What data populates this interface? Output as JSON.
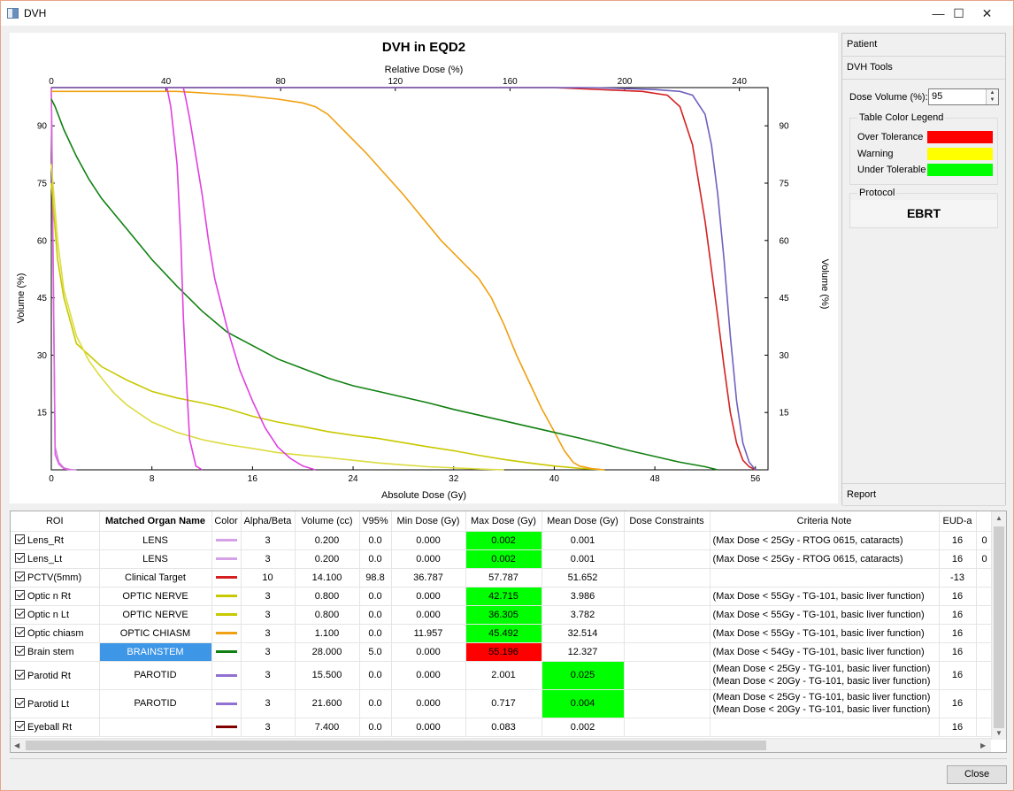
{
  "window": {
    "title": "DVH",
    "minimize": "—",
    "maximize": "☐",
    "close": "✕"
  },
  "chart": {
    "title": "DVH in EQD2",
    "top_axis_label": "Relative Dose (%)",
    "bottom_axis_label": "Absolute Dose (Gy)",
    "left_axis_label": "Volume (%)",
    "right_axis_label": "Volume (%)"
  },
  "chart_data": {
    "type": "line",
    "title": "DVH in EQD2",
    "xlabel": "Absolute Dose (Gy)",
    "x2label": "Relative Dose (%)",
    "ylabel": "Volume (%)",
    "xlim": [
      0,
      57
    ],
    "x2lim": [
      0,
      250
    ],
    "ylim": [
      0,
      100
    ],
    "x_ticks": [
      0,
      8,
      16,
      24,
      32,
      40,
      48,
      56
    ],
    "x2_ticks": [
      0,
      40,
      80,
      120,
      160,
      200,
      240
    ],
    "y_ticks": [
      15,
      30,
      45,
      60,
      75,
      90
    ],
    "series": [
      {
        "color": "#cc88dd",
        "x": [
          0,
          0.3,
          0.6,
          1,
          1.5,
          2
        ],
        "y": [
          100,
          6,
          2,
          0.5,
          0.1,
          0
        ]
      },
      {
        "color": "#e060e0",
        "x": [
          0,
          0.3,
          0.6,
          1,
          1.5
        ],
        "y": [
          100,
          4,
          1.5,
          0.3,
          0
        ]
      },
      {
        "color": "#d42020",
        "x": [
          0,
          40,
          47,
          49,
          50,
          51,
          52,
          53,
          53.5,
          54,
          54.5,
          55,
          55.5,
          56
        ],
        "y": [
          100,
          100,
          99,
          98,
          95,
          85,
          65,
          40,
          27,
          15,
          7,
          2.5,
          0.8,
          0
        ]
      },
      {
        "color": "#c8c800",
        "x": [
          0,
          0.5,
          1,
          2,
          4,
          6,
          8,
          10,
          12,
          14,
          16,
          18,
          20,
          22,
          24,
          26,
          28,
          30,
          32,
          34,
          36,
          38,
          40,
          42,
          44
        ],
        "y": [
          75,
          55,
          45,
          33,
          27,
          23.5,
          20.5,
          18.8,
          17.5,
          16,
          14,
          12.5,
          11.3,
          10,
          9,
          8.2,
          7.1,
          6,
          5,
          3.8,
          2.7,
          1.8,
          1,
          0.4,
          0
        ]
      },
      {
        "color": "#dcdc40",
        "x": [
          0,
          0.5,
          1,
          2,
          3,
          4,
          5,
          6,
          8,
          10,
          12,
          14,
          16,
          18,
          20,
          22,
          24,
          26,
          28,
          30,
          32,
          34,
          36
        ],
        "y": [
          80,
          60,
          47,
          35,
          28.5,
          24,
          20,
          17,
          12.5,
          9.8,
          7.9,
          6.6,
          5.6,
          4.5,
          3.8,
          3.2,
          2.5,
          1.8,
          1.3,
          0.8,
          0.5,
          0.2,
          0
        ]
      },
      {
        "color": "#f0a010",
        "x": [
          0,
          10,
          15,
          18,
          20,
          21,
          22,
          25,
          28,
          31,
          34,
          35,
          36,
          37,
          38,
          39,
          40,
          40.8,
          41.5,
          42,
          43,
          44
        ],
        "y": [
          99,
          99,
          98,
          97,
          96,
          95,
          93,
          83,
          72,
          60,
          50,
          45,
          38,
          30,
          23,
          16,
          10,
          5,
          2,
          1,
          0.3,
          0
        ]
      },
      {
        "color": "#108010",
        "x": [
          0,
          0.3,
          1,
          2,
          3,
          4,
          5,
          6,
          8,
          10,
          12,
          14,
          16,
          18,
          20,
          22,
          24,
          26,
          28,
          30,
          32,
          34,
          36,
          38,
          40,
          42,
          44,
          46,
          48,
          50,
          52,
          53
        ],
        "y": [
          97,
          95,
          89,
          82,
          76,
          71,
          67,
          63,
          55,
          48,
          41.5,
          36,
          32.5,
          29,
          26.5,
          24,
          22,
          20.5,
          19,
          17.5,
          15.8,
          14.3,
          12.8,
          11.3,
          9.8,
          8.3,
          6.7,
          5,
          3.5,
          2,
          0.8,
          0
        ]
      },
      {
        "color": "#7060c0",
        "x": [
          0,
          43,
          48,
          50,
          51,
          52,
          52.5,
          53,
          53.5,
          54,
          54.5,
          55,
          55.5,
          56
        ],
        "y": [
          100,
          100,
          99.5,
          99,
          98,
          93,
          85,
          72,
          55,
          35,
          18,
          7,
          2,
          0
        ]
      },
      {
        "color": "#e040e0",
        "x": [
          9.2,
          9.5,
          10,
          10.3,
          10.5,
          10.8,
          11,
          11.5,
          12
        ],
        "y": [
          100,
          95,
          80,
          60,
          40,
          20,
          8,
          1,
          0
        ]
      },
      {
        "color": "#e040e0",
        "x": [
          10.5,
          10.7,
          11,
          11.5,
          12,
          12.5,
          13,
          14,
          15,
          16,
          17,
          18,
          19,
          20,
          21
        ],
        "y": [
          100,
          97,
          92,
          82,
          72,
          60,
          50,
          37,
          26,
          18,
          11,
          6,
          3,
          1,
          0
        ]
      }
    ]
  },
  "right_panel": {
    "patient_label": "Patient",
    "dvh_tools_label": "DVH Tools",
    "dose_volume_label": "Dose Volume (%):",
    "dose_volume_value": "95",
    "legend_title": "Table Color Legend",
    "legend": [
      {
        "label": "Over Tolerance",
        "color": "#ff0000"
      },
      {
        "label": "Warning",
        "color": "#ffff00"
      },
      {
        "label": "Under Tolerable",
        "color": "#00ff00"
      }
    ],
    "protocol_title": "Protocol",
    "protocol_value": "EBRT",
    "report_label": "Report"
  },
  "table": {
    "headers": [
      "ROI",
      "Matched Organ Name",
      "Color",
      "Alpha/Beta",
      "Volume (cc)",
      "V95%",
      "Min Dose (Gy)",
      "Max Dose (Gy)",
      "Mean Dose (Gy)",
      "Dose Constraints",
      "Criteria Note",
      "EUD-a"
    ],
    "rows": [
      {
        "roi": "Lens_Rt",
        "organ": "LENS",
        "color": "#d4a0e8",
        "ab": "3",
        "vol": "0.200",
        "v95": "0.0",
        "min": "0.000",
        "max": "0.002",
        "mean": "0.001",
        "note": "(Max Dose < 25Gy - RTOG 0615, cataracts)",
        "eud": "16",
        "extra": "0"
      },
      {
        "roi": "Lens_Lt",
        "organ": "LENS",
        "color": "#d4a0e8",
        "ab": "3",
        "vol": "0.200",
        "v95": "0.0",
        "min": "0.000",
        "max": "0.002",
        "mean": "0.001",
        "note": "(Max Dose < 25Gy - RTOG 0615, cataracts)",
        "eud": "16",
        "extra": "0"
      },
      {
        "roi": "PCTV(5mm)",
        "organ": "Clinical Target",
        "color": "#d42020",
        "ab": "10",
        "vol": "14.100",
        "v95": "98.8",
        "min": "36.787",
        "max": "57.787",
        "mean": "51.652",
        "note": "",
        "eud": "-13",
        "extra": ""
      },
      {
        "roi": "Optic n Rt",
        "organ": "OPTIC NERVE",
        "color": "#c8c800",
        "ab": "3",
        "vol": "0.800",
        "v95": "0.0",
        "min": "0.000",
        "max": "42.715",
        "mean": "3.986",
        "note": "(Max Dose < 55Gy - TG-101, basic liver function)",
        "eud": "16",
        "extra": ""
      },
      {
        "roi": "Optic n Lt",
        "organ": "OPTIC NERVE",
        "color": "#c8c800",
        "ab": "3",
        "vol": "0.800",
        "v95": "0.0",
        "min": "0.000",
        "max": "36.305",
        "mean": "3.782",
        "note": "(Max Dose < 55Gy - TG-101, basic liver function)",
        "eud": "16",
        "extra": ""
      },
      {
        "roi": "Optic chiasm",
        "organ": "OPTIC CHIASM",
        "color": "#f0a010",
        "ab": "3",
        "vol": "1.100",
        "v95": "0.0",
        "min": "11.957",
        "max": "45.492",
        "mean": "32.514",
        "note": "(Max Dose < 55Gy - TG-101, basic liver function)",
        "eud": "16",
        "extra": ""
      },
      {
        "roi": "Brain stem",
        "organ": "BRAINSTEM",
        "color": "#108010",
        "ab": "3",
        "vol": "28.000",
        "v95": "5.0",
        "min": "0.000",
        "max": "55.196",
        "mean": "12.327",
        "note": "(Max Dose < 54Gy - TG-101, basic liver function)",
        "eud": "16",
        "extra": ""
      },
      {
        "roi": "Parotid Rt",
        "organ": "PAROTID",
        "color": "#9070d0",
        "ab": "3",
        "vol": "15.500",
        "v95": "0.0",
        "min": "0.000",
        "max": "2.001",
        "mean": "0.025",
        "note": "(Mean Dose < 25Gy - TG-101, basic liver function)",
        "note2": "(Mean Dose < 20Gy - TG-101, basic liver function)",
        "eud": "16",
        "extra": ""
      },
      {
        "roi": "Parotid Lt",
        "organ": "PAROTID",
        "color": "#9070d0",
        "ab": "3",
        "vol": "21.600",
        "v95": "0.0",
        "min": "0.000",
        "max": "0.717",
        "mean": "0.004",
        "note": "(Mean Dose < 25Gy - TG-101, basic liver function)",
        "note2": "(Mean Dose < 20Gy - TG-101, basic liver function)",
        "eud": "16",
        "extra": ""
      },
      {
        "roi": "Eyeball Rt",
        "organ": "",
        "color": "#800000",
        "ab": "3",
        "vol": "7.400",
        "v95": "0.0",
        "min": "0.000",
        "max": "0.083",
        "mean": "0.002",
        "note": "",
        "eud": "16",
        "extra": ""
      }
    ]
  },
  "footer": {
    "close_label": "Close"
  }
}
